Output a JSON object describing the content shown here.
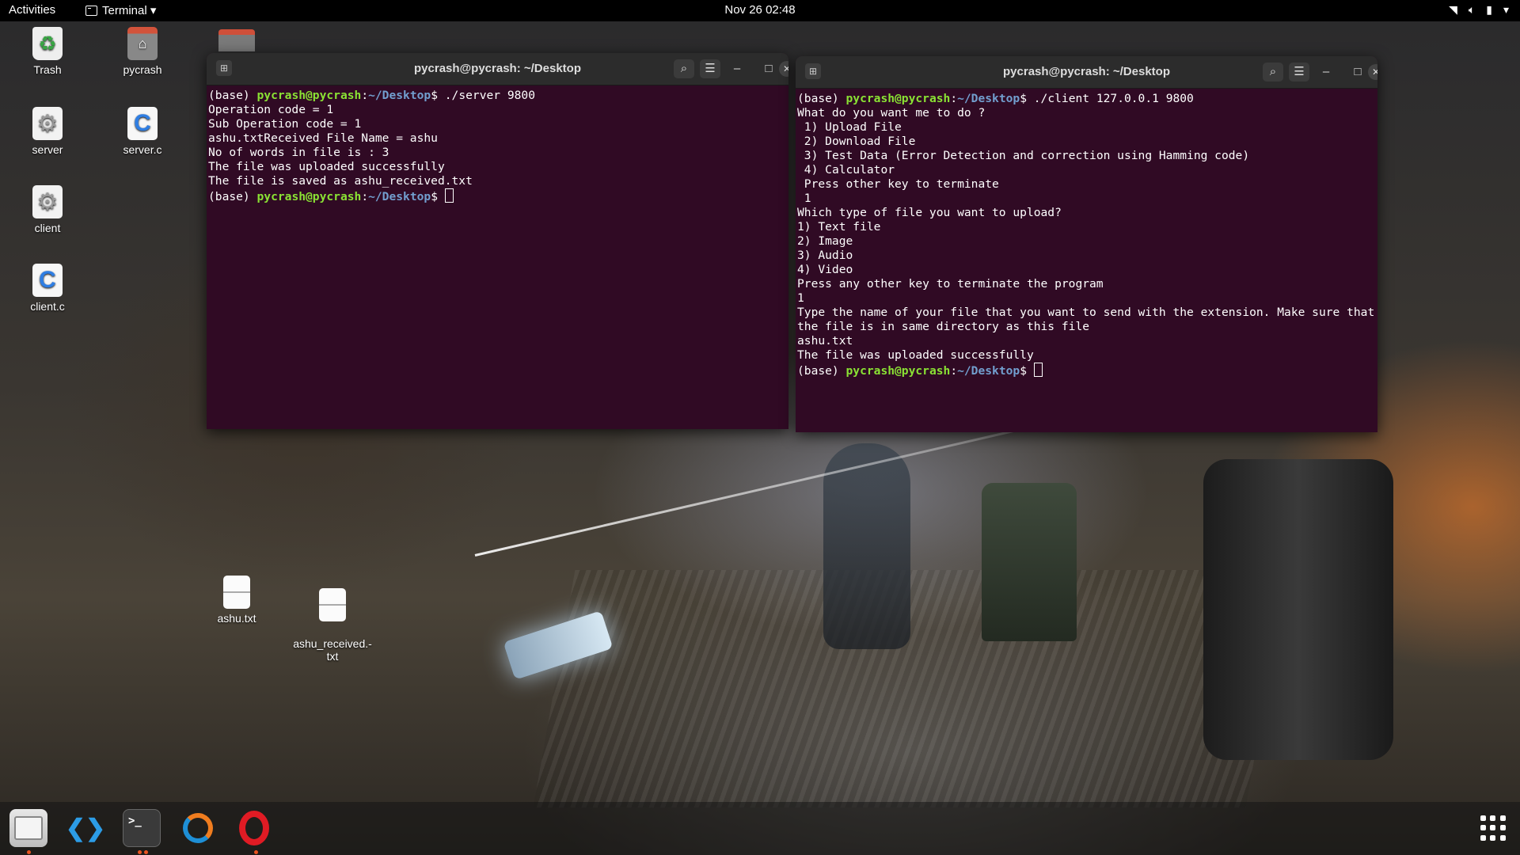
{
  "topbar": {
    "activities": "Activities",
    "app_menu": "Terminal ▾",
    "clock": "Nov 26  02:48",
    "status_icons": [
      "wifi-icon",
      "volume-icon",
      "battery-icon",
      "chevron-down-icon"
    ]
  },
  "desktop": {
    "icons": {
      "trash": "Trash",
      "pycrash": "pycrash",
      "server": "server",
      "server_c": "server.c",
      "client": "client",
      "client_c": "client.c",
      "ashu_txt": "ashu.txt",
      "ashu_received": "ashu_received.-\ntxt"
    }
  },
  "left_terminal": {
    "title": "pycrash@pycrash: ~/Desktop",
    "prompt_base": "(base) ",
    "prompt_user": "pycrash@pycrash",
    "prompt_sep": ":",
    "prompt_path": "~/Desktop",
    "prompt_end": "$ ",
    "command": "./server 9800",
    "output": "Operation code = 1\nSub Operation code = 1\nashu.txtReceived File Name = ashu\nNo of words in file is : 3\nThe file was uploaded successfully\nThe file is saved as ashu_received.txt"
  },
  "right_terminal": {
    "title": "pycrash@pycrash: ~/Desktop",
    "prompt_base": "(base) ",
    "prompt_user": "pycrash@pycrash",
    "prompt_sep": ":",
    "prompt_path": "~/Desktop",
    "prompt_end": "$ ",
    "command": "./client 127.0.0.1 9800",
    "output": "What do you want me to do ?\n 1) Upload File\n 2) Download File\n 3) Test Data (Error Detection and correction using Hamming code)\n 4) Calculator\n Press other key to terminate\n 1\nWhich type of file you want to upload?\n1) Text file\n2) Image\n3) Audio\n4) Video\nPress any other key to terminate the program\n1\nType the name of your file that you want to send with the extension. Make sure that the file is in same directory as this file\nashu.txt\nThe file was uploaded successfully"
  },
  "window_controls": {
    "newtab": "⊞",
    "search": "⌕",
    "menu": "☰",
    "minimize": "–",
    "maximize": "□",
    "close": "✕"
  },
  "dock": {
    "items": [
      "files-icon",
      "vscode-icon",
      "terminal-icon",
      "software-updater-icon",
      "opera-icon"
    ],
    "terminal_glyph": ">_",
    "vscode_glyph": "❮❯",
    "opera_glyph": "O"
  },
  "colors": {
    "terminal_bg": "#300a24",
    "prompt_user": "#8ae234",
    "prompt_path": "#729fcf",
    "accent": "#e95420"
  }
}
